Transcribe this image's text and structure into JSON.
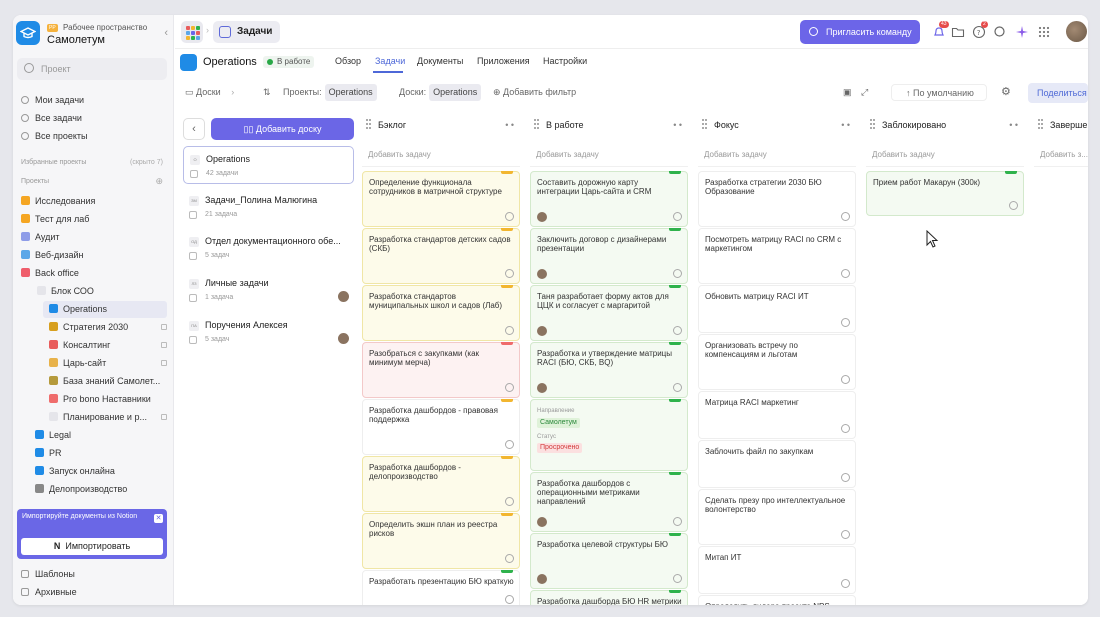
{
  "workspace": {
    "badge": "PP",
    "subtitle": "Рабочее пространство",
    "name": "Самолетум"
  },
  "sidebar": {
    "search_placeholder": "Проект",
    "nav": [
      "Мои задачи",
      "Все задачи",
      "Все проекты"
    ],
    "favorites_label": "Избранные проекты",
    "favorites_hidden": "(скрыто 7)",
    "projects_label": "Проекты",
    "projects": [
      {
        "label": "Исследования",
        "color": "#f5a623"
      },
      {
        "label": "Тест для лаб",
        "color": "#f5a623"
      },
      {
        "label": "Аудит",
        "color": "#8e9ce8"
      },
      {
        "label": "Веб-дизайн",
        "color": "#5ba7e8"
      },
      {
        "label": "Back office",
        "color": "#ef5d6b"
      },
      {
        "label": "Блок СОО",
        "color": "#e5e5ea"
      },
      {
        "label": "Operations",
        "color": "#1f8be6"
      },
      {
        "label": "Стратегия 2030",
        "color": "#d79f1e"
      },
      {
        "label": "Консалтинг",
        "color": "#e85c5c"
      },
      {
        "label": "Царь-сайт",
        "color": "#e8b24a"
      },
      {
        "label": "База знаний Самолет...",
        "color": "#b59a3c"
      },
      {
        "label": "Pro bono Наставники",
        "color": "#ef6c6c"
      },
      {
        "label": "Планирование и р...",
        "color": "#e5e5ea"
      },
      {
        "label": "Legal",
        "color": "#1f8be6"
      },
      {
        "label": "PR",
        "color": "#1f8be6"
      },
      {
        "label": "Запуск онлайна",
        "color": "#1f8be6"
      },
      {
        "label": "Делопроизводство",
        "color": "#888"
      }
    ],
    "notion_text": "Импортируйте документы из Notion",
    "notion_button": "Импортировать",
    "bottom": [
      "Шаблоны",
      "Архивные"
    ]
  },
  "topbar": {
    "crumb": "Задачи",
    "invite": "Пригласить команду",
    "notif_count": "43",
    "help_count": "2"
  },
  "project": {
    "name": "Operations",
    "status": "В работе",
    "tabs": [
      "Обзор",
      "Задачи",
      "Документы",
      "Приложения",
      "Настройки"
    ],
    "active_tab": 1
  },
  "filters": {
    "boards": "Доски",
    "projects_label": "Проекты:",
    "projects_value": "Operations",
    "boards_label": "Доски:",
    "boards_value": "Operations",
    "add_filter": "Добавить фильтр",
    "sort": "По умолчанию",
    "share": "Поделиться"
  },
  "boards": {
    "add": "Добавить доску",
    "items": [
      {
        "abbr": "O",
        "name": "Operations",
        "count": "42 задачи"
      },
      {
        "abbr": "ЗМ",
        "name": "Задачи_Полина Малюгина",
        "count": "21 задача"
      },
      {
        "abbr": "ОД",
        "name": "Отдел документационного обе...",
        "count": "5 задач"
      },
      {
        "abbr": "ЛЗ",
        "name": "Личные задачи",
        "count": "1 задача"
      },
      {
        "abbr": "ПА",
        "name": "Поручения Алексея",
        "count": "5 задач"
      }
    ]
  },
  "columns": [
    {
      "title": "Бэклог",
      "add": "Добавить задачу",
      "cards": [
        {
          "text": "Определение функционала сотрудников в матричной структуре",
          "tone": "y",
          "flag": "#f2b630"
        },
        {
          "text": "Разработка стандартов детских садов (СКБ)",
          "tone": "y",
          "flag": "#f2b630"
        },
        {
          "text": "Разработка стандартов муниципальных школ и садов (Лаб)",
          "tone": "y",
          "flag": "#f2b630"
        },
        {
          "text": "Разобраться с закупками (как минимум мерча)",
          "tone": "r",
          "flag": "#ef6b6b"
        },
        {
          "text": "Разработка дашбордов - правовая поддержка",
          "tone": "w",
          "flag": "#f2b630"
        },
        {
          "text": "Разработка дашбордов - делопроизводство",
          "tone": "y",
          "flag": "#f2b630"
        },
        {
          "text": "Определить экшн план из реестра рисков",
          "tone": "y",
          "flag": "#f2b630"
        },
        {
          "text": "Разработать презентацию БЮ краткую",
          "tone": "w",
          "flag": "#2fb24c"
        }
      ]
    },
    {
      "title": "В работе",
      "add": "Добавить задачу",
      "cards": [
        {
          "text": "Составить дорожную карту интеграции Царь-сайта и CRM",
          "tone": "g",
          "flag": "#2fb24c"
        },
        {
          "text": "Заключить договор с дизайнерами презентации",
          "tone": "g",
          "flag": "#2fb24c"
        },
        {
          "text": "Таня разработает форму актов для ЦЦК и согласует с маргаритой",
          "tone": "g",
          "flag": "#2fb24c"
        },
        {
          "text": "Разработка и утверждение матрицы RACI (БЮ, СКБ, BQ)",
          "tone": "g",
          "flag": "#2fb24c"
        },
        {
          "text": "",
          "tone": "g",
          "flag": "#2fb24c"
        },
        {
          "text": "Разработка дашбордов с операционными метриками направлений",
          "tone": "g",
          "flag": "#2fb24c"
        },
        {
          "text": "Разработка целевой структуры БЮ",
          "tone": "g",
          "flag": "#2fb24c"
        },
        {
          "text": "Разработка дашборда БЮ HR метрики",
          "tone": "g",
          "flag": "#2fb24c"
        }
      ],
      "extra": {
        "direction_label": "Направление",
        "direction": "Самолетум",
        "status_label": "Статус",
        "status": "Просрочено"
      }
    },
    {
      "title": "Фокус",
      "add": "Добавить задачу",
      "cards": [
        {
          "text": "Разработка стратегии 2030 БЮ Образование"
        },
        {
          "text": "Посмотреть матрицу RACI по CRM с маркетингом"
        },
        {
          "text": "Обновить матрицу RACI ИТ"
        },
        {
          "text": "Организовать встречу по компенсациям и льготам"
        },
        {
          "text": "Матрица RACI маркетинг"
        },
        {
          "text": "Заблочить файл по закупкам"
        },
        {
          "text": "Сделать презу про интеллектуальное волонтерство"
        },
        {
          "text": "Митап ИТ"
        },
        {
          "text": "Определить лидера проекта NPS"
        }
      ]
    },
    {
      "title": "Заблокировано",
      "add": "Добавить задачу",
      "cards": [
        {
          "text": "Прием работ Макарун (300к)",
          "tone": "g",
          "flag": "#2fb24c"
        }
      ]
    },
    {
      "title": "Заверше...",
      "add": "Добавить з...",
      "cards": []
    }
  ]
}
